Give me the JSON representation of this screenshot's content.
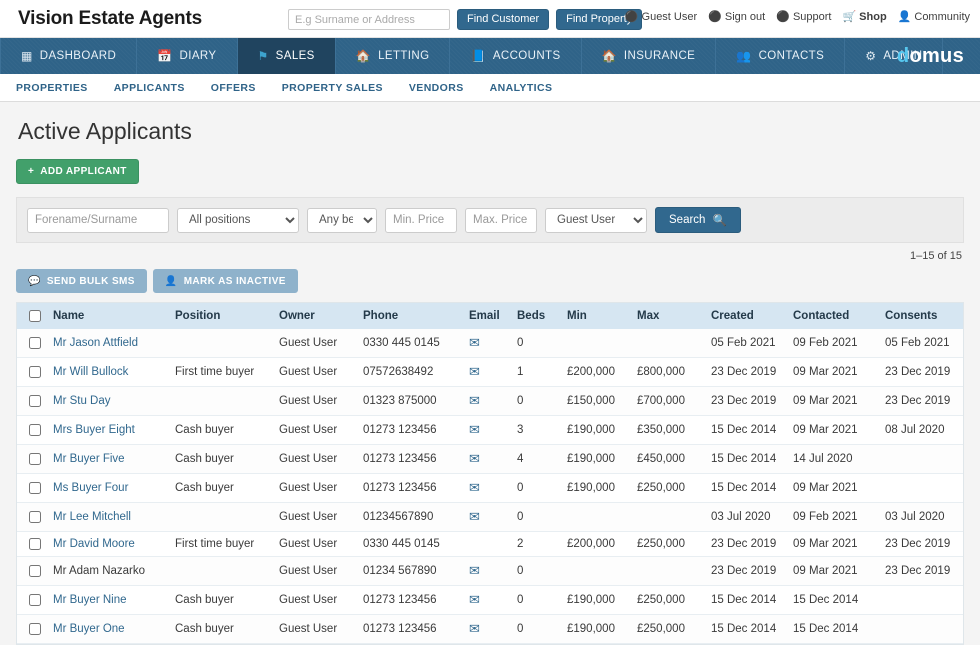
{
  "header": {
    "brand": "Vision Estate Agents",
    "search_placeholder": "E.g Surname or Address",
    "search_value": "",
    "find_customer_label": "Find Customer",
    "find_property_label": "Find Property",
    "links": [
      {
        "label": "Guest User",
        "icon": "user-circle-icon",
        "bold": false
      },
      {
        "label": "Sign out",
        "icon": "sign-out-icon",
        "bold": false
      },
      {
        "label": "Support",
        "icon": "info-circle-icon",
        "bold": false
      },
      {
        "label": "Shop",
        "icon": "shopping-cart-icon",
        "bold": true
      },
      {
        "label": "Community",
        "icon": "person-icon",
        "bold": false
      }
    ]
  },
  "mainnav": {
    "items": [
      {
        "label": "DASHBOARD",
        "icon": "grid-icon",
        "active": false
      },
      {
        "label": "DIARY",
        "icon": "calendar-icon",
        "active": false
      },
      {
        "label": "SALES",
        "icon": "flag-icon",
        "active": true
      },
      {
        "label": "LETTING",
        "icon": "home-icon",
        "active": false
      },
      {
        "label": "ACCOUNTS",
        "icon": "book-icon",
        "active": false
      },
      {
        "label": "INSURANCE",
        "icon": "home-icon",
        "active": false
      },
      {
        "label": "CONTACTS",
        "icon": "people-icon",
        "active": false
      },
      {
        "label": "ADMIN",
        "icon": "gear-icon",
        "active": false
      }
    ],
    "logo_first": "d",
    "logo_rest": "omus"
  },
  "subnav": {
    "items": [
      {
        "label": "PROPERTIES"
      },
      {
        "label": "APPLICANTS"
      },
      {
        "label": "OFFERS"
      },
      {
        "label": "PROPERTY SALES"
      },
      {
        "label": "VENDORS"
      },
      {
        "label": "ANALYTICS"
      }
    ]
  },
  "page": {
    "title": "Active Applicants",
    "add_applicant_label": "ADD APPLICANT",
    "result_count": "1–15 of 15"
  },
  "filters": {
    "name_placeholder": "Forename/Surname",
    "name_value": "",
    "position_selected": "All positions",
    "position_options": [
      "All positions"
    ],
    "beds_selected": "Any beds",
    "beds_options": [
      "Any beds"
    ],
    "min_price_placeholder": "Min. Price",
    "min_price_value": "",
    "max_price_placeholder": "Max. Price",
    "max_price_value": "",
    "user_selected": "Guest User",
    "user_options": [
      "Guest User"
    ],
    "search_label": "Search"
  },
  "bulk_actions": {
    "send_bulk_sms_label": "SEND BULK SMS",
    "mark_inactive_label": "MARK AS INACTIVE"
  },
  "table": {
    "columns": [
      "Name",
      "Position",
      "Owner",
      "Phone",
      "Email",
      "Beds",
      "Min",
      "Max",
      "Created",
      "Contacted",
      "Consents"
    ],
    "rows": [
      {
        "name": "Mr Jason Attfield",
        "is_link": true,
        "position": "",
        "owner": "Guest User",
        "phone": "0330 445 0145",
        "email": true,
        "beds": "0",
        "min": "",
        "max": "",
        "created": "05 Feb 2021",
        "contacted": "09 Feb 2021",
        "consents": "05 Feb 2021"
      },
      {
        "name": "Mr Will Bullock",
        "is_link": true,
        "position": "First time buyer",
        "owner": "Guest User",
        "phone": "07572638492",
        "email": true,
        "beds": "1",
        "min": "£200,000",
        "max": "£800,000",
        "created": "23 Dec 2019",
        "contacted": "09 Mar 2021",
        "consents": "23 Dec 2019"
      },
      {
        "name": "Mr Stu Day",
        "is_link": true,
        "position": "",
        "owner": "Guest User",
        "phone": "01323 875000",
        "email": true,
        "beds": "0",
        "min": "£150,000",
        "max": "£700,000",
        "created": "23 Dec 2019",
        "contacted": "09 Mar 2021",
        "consents": "23 Dec 2019"
      },
      {
        "name": "Mrs Buyer Eight",
        "is_link": true,
        "position": "Cash buyer",
        "owner": "Guest User",
        "phone": "01273 123456",
        "email": true,
        "beds": "3",
        "min": "£190,000",
        "max": "£350,000",
        "created": "15 Dec 2014",
        "contacted": "09 Mar 2021",
        "consents": "08 Jul 2020"
      },
      {
        "name": "Mr Buyer Five",
        "is_link": true,
        "position": "Cash buyer",
        "owner": "Guest User",
        "phone": "01273 123456",
        "email": true,
        "beds": "4",
        "min": "£190,000",
        "max": "£450,000",
        "created": "15 Dec 2014",
        "contacted": "14 Jul 2020",
        "consents": ""
      },
      {
        "name": "Ms Buyer Four",
        "is_link": true,
        "position": "Cash buyer",
        "owner": "Guest User",
        "phone": "01273 123456",
        "email": true,
        "beds": "0",
        "min": "£190,000",
        "max": "£250,000",
        "created": "15 Dec 2014",
        "contacted": "09 Mar 2021",
        "consents": ""
      },
      {
        "name": "Mr Lee Mitchell",
        "is_link": true,
        "position": "",
        "owner": "Guest User",
        "phone": "01234567890",
        "email": true,
        "beds": "0",
        "min": "",
        "max": "",
        "created": "03 Jul 2020",
        "contacted": "09 Feb 2021",
        "consents": "03 Jul 2020"
      },
      {
        "name": "Mr David Moore",
        "is_link": true,
        "position": "First time buyer",
        "owner": "Guest User",
        "phone": "0330 445 0145",
        "email": false,
        "beds": "2",
        "min": "£200,000",
        "max": "£250,000",
        "created": "23 Dec 2019",
        "contacted": "09 Mar 2021",
        "consents": "23 Dec 2019"
      },
      {
        "name": "Mr Adam Nazarko",
        "is_link": false,
        "position": "",
        "owner": "Guest User",
        "phone": "01234 567890",
        "email": true,
        "beds": "0",
        "min": "",
        "max": "",
        "created": "23 Dec 2019",
        "contacted": "09 Mar 2021",
        "consents": "23 Dec 2019"
      },
      {
        "name": "Mr Buyer Nine",
        "is_link": true,
        "position": "Cash buyer",
        "owner": "Guest User",
        "phone": "01273 123456",
        "email": true,
        "beds": "0",
        "min": "£190,000",
        "max": "£250,000",
        "created": "15 Dec 2014",
        "contacted": "15 Dec 2014",
        "consents": ""
      },
      {
        "name": "Mr Buyer One",
        "is_link": true,
        "position": "Cash buyer",
        "owner": "Guest User",
        "phone": "01273 123456",
        "email": true,
        "beds": "0",
        "min": "£190,000",
        "max": "£250,000",
        "created": "15 Dec 2014",
        "contacted": "15 Dec 2014",
        "consents": ""
      }
    ]
  },
  "colors": {
    "nav_blue": "#2f6388",
    "nav_active": "#20445f",
    "accent_link": "#31688e",
    "green": "#42a06b",
    "table_header": "#d6e6f2",
    "logo_cyan": "#56c7ef"
  }
}
